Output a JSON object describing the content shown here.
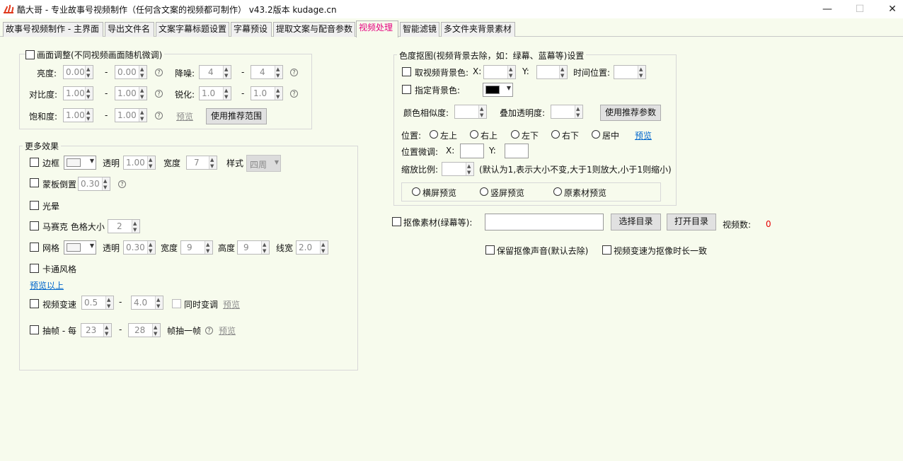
{
  "window": {
    "title": "酷大哥 - 专业故事号视频制作（任何含文案的视频都可制作） v43.2版本 kudage.cn",
    "minimize": "—",
    "maximize": "☐",
    "close": "✕"
  },
  "tabs": [
    "故事号视频制作 - 主界面",
    "导出文件名",
    "文案字幕标题设置",
    "字幕预设",
    "提取文案与配音参数",
    "视频处理",
    "智能滤镜",
    "多文件夹背景素材"
  ],
  "picture_adjust": {
    "title": "画面调整(不同视频画面随机微调)",
    "brightness_label": "亮度:",
    "brightness_min": "0.00",
    "brightness_max": "0.00",
    "noise_label": "降噪:",
    "noise_min": "4",
    "noise_max": "4",
    "contrast_label": "对比度:",
    "contrast_min": "1.00",
    "contrast_max": "1.00",
    "sharpen_label": "锐化:",
    "sharpen_min": "1.0",
    "sharpen_max": "1.0",
    "saturation_label": "饱和度:",
    "saturation_min": "1.00",
    "saturation_max": "1.00",
    "preview": "预览",
    "recommend_btn": "使用推荐范围",
    "dash": "-"
  },
  "more_effects": {
    "title": "更多效果",
    "border_label": "边框",
    "opacity_label": "透明",
    "border_opacity": "1.00",
    "width_label": "宽度",
    "border_width": "7",
    "style_label": "样式",
    "border_style": "四周",
    "mask_label": "蒙板倒置",
    "mask_value": "0.30",
    "halo_label": "光晕",
    "mosaic_label": "马赛克 色格大小",
    "mosaic_value": "2",
    "grid_label": "网格",
    "grid_opacity": "0.30",
    "grid_width": "9",
    "height_label": "高度",
    "grid_height": "9",
    "line_label": "线宽",
    "grid_line": "2.0",
    "cartoon_label": "卡通风格",
    "preview_above": "预览以上",
    "speed_label": "视频变速",
    "speed_min": "0.5",
    "speed_max": "4.0",
    "sync_label": "同时变调",
    "speed_preview": "预览",
    "frame_label": "抽帧 - 每",
    "frame_min": "23",
    "frame_max": "28",
    "frame_suffix": "帧抽一帧",
    "frame_preview": "预览"
  },
  "chroma": {
    "title": "色度抠图(视频背景去除，如：绿幕、蓝幕等)设置",
    "take_bg_label": "取视频背景色:",
    "x_label": "X:",
    "y_label": "Y:",
    "time_label": "时间位置:",
    "set_bg_label": "指定背景色:",
    "bg_color": "#000000",
    "similarity_label": "颜色相似度:",
    "opacity_label": "叠加透明度:",
    "recommend_btn": "使用推荐参数",
    "position_label": "位置:",
    "positions": [
      "左上",
      "右上",
      "左下",
      "右下",
      "居中"
    ],
    "preview": "预览",
    "fine_label": "位置微调:",
    "fx_label": "X:",
    "fy_label": "Y:",
    "scale_label": "缩放比例:",
    "scale_hint": "(默认为1,表示大小不变,大于1则放大,小于1则缩小)",
    "previews": [
      "横屏预览",
      "竖屏预览",
      "原素材预览"
    ]
  },
  "keying": {
    "label": "抠像素材(绿幕等):",
    "path": "",
    "select_btn": "选择目录",
    "open_btn": "打开目录",
    "count_label": "视频数:",
    "count": "0",
    "count_color": "#e60000",
    "keep_audio": "保留抠像声音(默认去除)",
    "match_speed": "视频变速为抠像时长一致"
  }
}
